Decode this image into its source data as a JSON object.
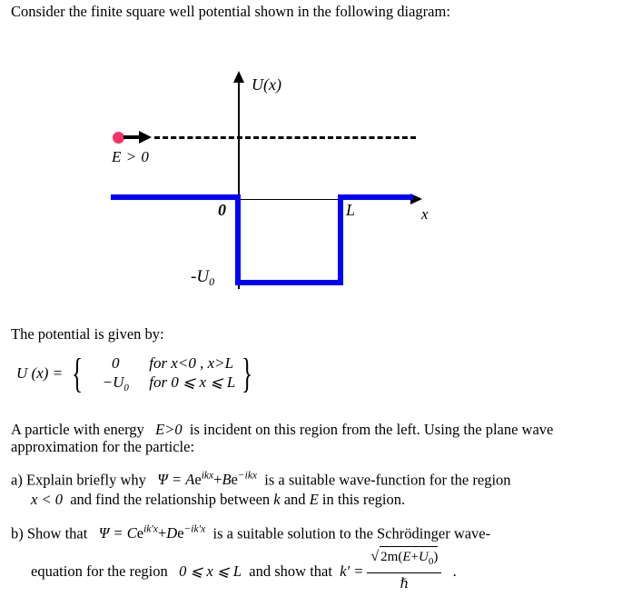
{
  "intro": {
    "text": "Consider the finite square well potential shown in the following diagram:"
  },
  "diagram": {
    "y_axis_label": "U(x)",
    "x_axis_label": "x",
    "origin_label": "0",
    "well_width_label": "L",
    "well_depth_label": "-U",
    "well_depth_subscript": "0",
    "energy_label": "E > 0",
    "particle_icon": "particle-dot-icon",
    "colors": {
      "potential": "#0000ff",
      "axis": "#000000",
      "particle": "#f8336b",
      "energy_level": "#000000"
    }
  },
  "potential_section": {
    "heading": "The potential is given by:",
    "equation": {
      "lhs": "U (x) =",
      "cases": [
        {
          "value": "0",
          "value_sub": "",
          "condition": "for  x<0 ,  x>L"
        },
        {
          "value": "−U",
          "value_sub": "0",
          "condition": "for  0 ⩽ x ⩽ L"
        }
      ]
    }
  },
  "particle_paragraph": {
    "part1": "A particle with energy",
    "energy": "E>0",
    "part2": "is incident on this region from the left. Using the plane wave approximation for the particle:"
  },
  "questions": [
    {
      "marker": "a)",
      "line1_part1": "Explain briefly why",
      "equation": {
        "psi": "Ψ =",
        "term1_coef": "A",
        "term1_base": "e",
        "term1_exp": "ikx",
        "plus": "+",
        "term2_coef": "B",
        "term2_base": "e",
        "term2_exp": "−ikx"
      },
      "line1_part2": "is a suitable wave-function for the region",
      "line2_part1": "x < 0",
      "line2_part2": "and find the relationship between",
      "line2_k": "k",
      "line2_and": "and",
      "line2_e": "E",
      "line2_part3": "in this region."
    },
    {
      "marker": "b)",
      "line1_part1": "Show that",
      "equation": {
        "psi": "Ψ =",
        "term1_coef": "C",
        "term1_base": "e",
        "term1_exp": "ik′x",
        "plus": "+",
        "term2_coef": "D",
        "term2_base": "e",
        "term2_exp": "−ik′x"
      },
      "line1_part2": "is a suitable solution to the Schrödinger wave-",
      "line2_part1": "equation for the region",
      "line2_region": "0 ⩽ x ⩽ L",
      "line2_part2": "and show that",
      "line2_k": "k′ =",
      "fraction": {
        "radical": "√",
        "numerator_roman": "2m",
        "numerator_paren_open": "(",
        "numerator_e": "E",
        "numerator_plus": "+",
        "numerator_u": "U",
        "numerator_u_sub": "0",
        "numerator_paren_close": ")",
        "denominator": "ℏ"
      },
      "trailing": "."
    }
  ]
}
